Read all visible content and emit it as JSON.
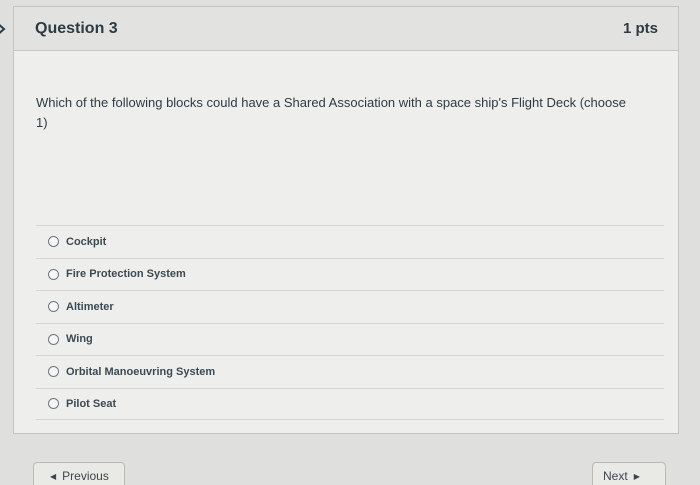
{
  "question": {
    "title": "Question 3",
    "points": "1 pts",
    "text": "Which of the following blocks could have a Shared Association with a space ship's Flight Deck (choose 1)"
  },
  "answers": [
    {
      "label": "Cockpit"
    },
    {
      "label": "Fire Protection System"
    },
    {
      "label": "Altimeter"
    },
    {
      "label": "Wing"
    },
    {
      "label": "Orbital Manoeuvring System"
    },
    {
      "label": "Pilot Seat"
    }
  ],
  "navigation": {
    "previous_label": "Previous",
    "next_label": "Next",
    "previous_icon": "caret-left-icon",
    "next_icon": "caret-right-icon"
  }
}
